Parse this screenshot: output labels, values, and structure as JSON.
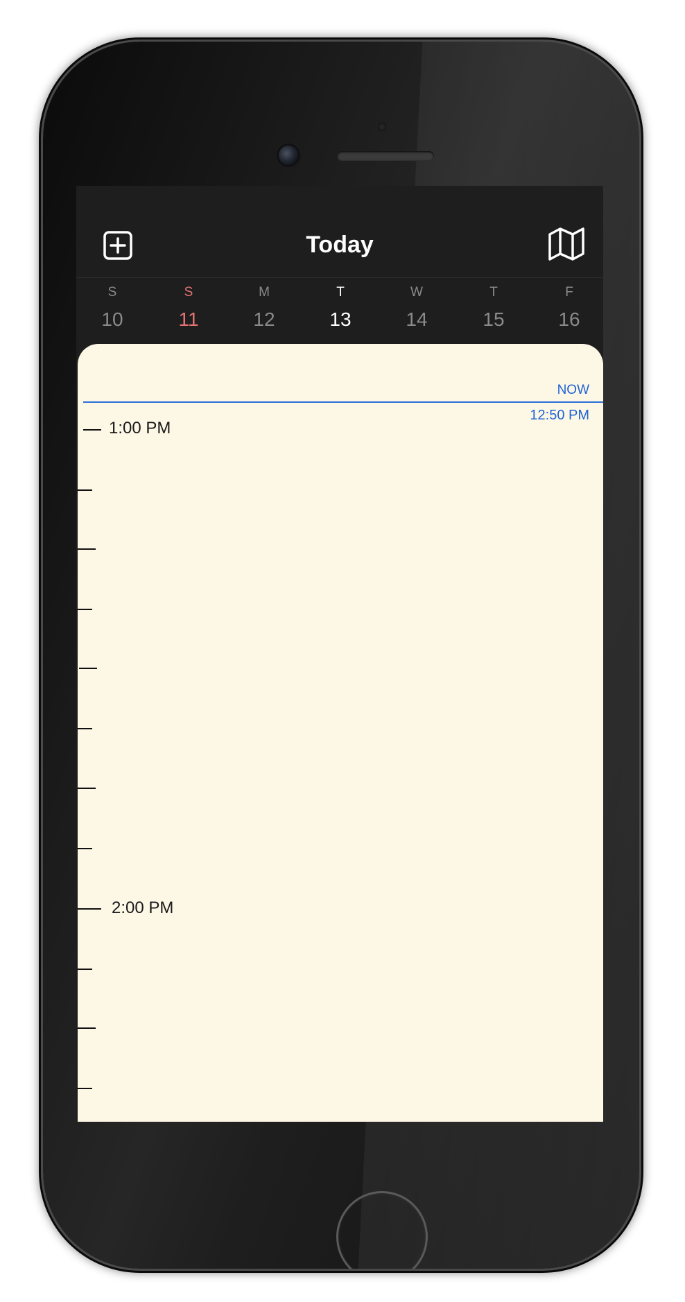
{
  "header": {
    "title": "Today",
    "add_icon": "plus-square-icon",
    "map_icon": "map-icon"
  },
  "week": {
    "days": [
      {
        "letter": "S",
        "number": "10"
      },
      {
        "letter": "S",
        "number": "11",
        "highlight": "sunday"
      },
      {
        "letter": "M",
        "number": "12"
      },
      {
        "letter": "T",
        "number": "13",
        "highlight": "today"
      },
      {
        "letter": "W",
        "number": "14"
      },
      {
        "letter": "T",
        "number": "15"
      },
      {
        "letter": "F",
        "number": "16"
      }
    ]
  },
  "timeline": {
    "now_label": "NOW",
    "now_time": "12:50 PM",
    "hours": [
      "1:00 PM",
      "2:00 PM"
    ]
  },
  "colors": {
    "header_bg": "#1e1e1e",
    "timeline_bg": "#fdf7e6",
    "now_blue": "#1e63d6",
    "sunday_red": "#e57373"
  }
}
